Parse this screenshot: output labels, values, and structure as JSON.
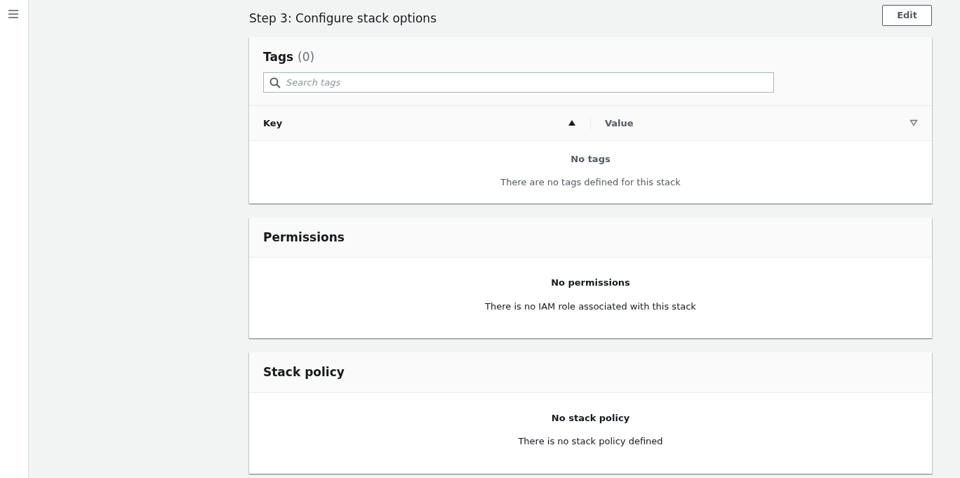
{
  "step_title": "Step 3: Configure stack options",
  "edit_button": "Edit",
  "tags_panel": {
    "title": "Tags",
    "count": "(0)",
    "search": {
      "placeholder": "Search tags"
    },
    "columns": [
      {
        "label": "Key",
        "sorted": true
      },
      {
        "label": "Value",
        "sorted": false
      }
    ],
    "empty_title": "No tags",
    "empty_text": "There are no tags defined for this stack"
  },
  "panels": [
    {
      "title": "Permissions",
      "empty_title": "No permissions",
      "empty_text": "There is no IAM role associated with this stack"
    },
    {
      "title": "Stack policy",
      "empty_title": "No stack policy",
      "empty_text": "There is no stack policy defined"
    }
  ]
}
